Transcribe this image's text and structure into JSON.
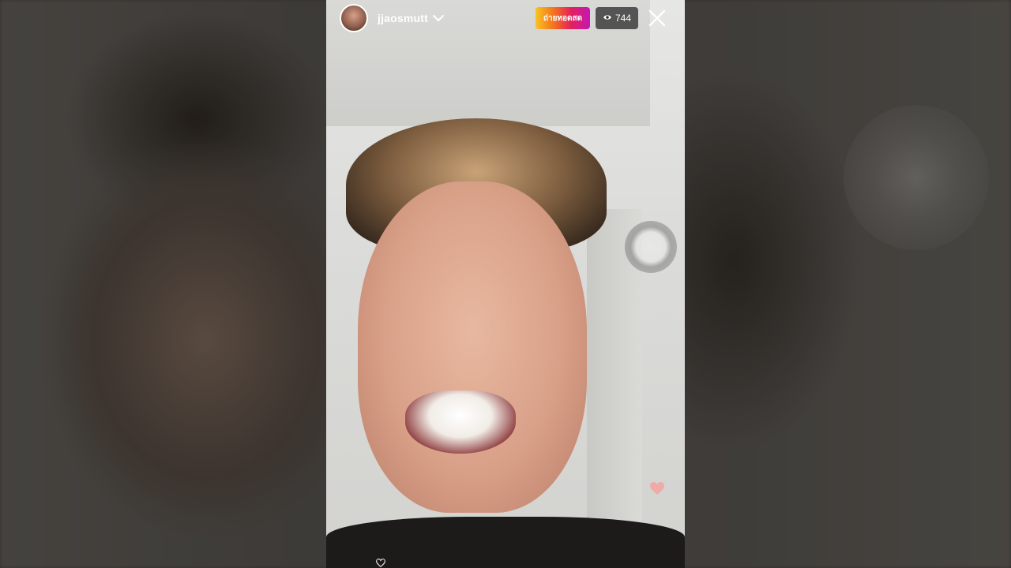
{
  "header": {
    "username": "jjaosmutt",
    "live_badge_label": "ถ่ายทอดสด",
    "viewer_count": "744"
  },
  "icons": {
    "avatar": "profile-avatar",
    "chevron": "chevron-down-icon",
    "viewers": "eye-icon",
    "close": "close-icon",
    "capture": "ring-icon",
    "like": "heart-icon"
  },
  "colors": {
    "live_gradient_start": "#f9c420",
    "live_gradient_end": "#c517b4",
    "viewer_bg": "#282828",
    "heart": "#f2a3a0"
  }
}
